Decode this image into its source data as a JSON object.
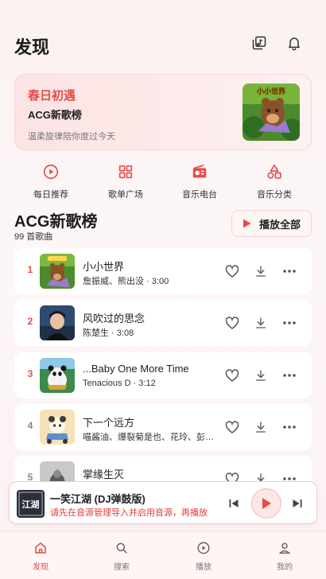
{
  "header": {
    "title": "发现",
    "icons": [
      "music-library-icon",
      "bell-icon"
    ]
  },
  "banner": {
    "title": "春日初遇",
    "subtitle": "ACG新歌榜",
    "description": "温柔旋律陪你度过今天",
    "art_text": "小小世界"
  },
  "quick_links": [
    {
      "label": "每日推荐",
      "icon": "play-circle-icon"
    },
    {
      "label": "歌单广场",
      "icon": "grid-icon"
    },
    {
      "label": "音乐电台",
      "icon": "radio-icon"
    },
    {
      "label": "音乐分类",
      "icon": "category-shapes-icon"
    }
  ],
  "section": {
    "title": "ACG新歌榜",
    "count": "99 首歌曲",
    "play_all_label": "播放全部"
  },
  "songs": [
    {
      "index": "1",
      "title": "小小世界",
      "meta": "詹振威、熊出没 · 3:00"
    },
    {
      "index": "2",
      "title": "风吹过的思念",
      "meta": "陈楚生 · 3:08"
    },
    {
      "index": "3",
      "title": "...Baby One More Time",
      "meta": "Tenacious D · 3:12"
    },
    {
      "index": "4",
      "title": "下一个远方",
      "meta": "喵酱油、爆裂菊是也、花玲、彭…"
    },
    {
      "index": "5",
      "title": "掌缘生灭",
      "meta": ""
    }
  ],
  "player": {
    "title": "一笑江湖 (DJ弹鼓版)",
    "status": "请先在音源管理导入并启用音源，再播放",
    "cover_text": "江湖"
  },
  "tabs": [
    {
      "label": "发现",
      "icon": "home-icon",
      "active": true
    },
    {
      "label": "搜索",
      "icon": "search-icon",
      "active": false
    },
    {
      "label": "播放",
      "icon": "play-circle-icon",
      "active": false
    },
    {
      "label": "我的",
      "icon": "user-icon",
      "active": false
    }
  ],
  "colors": {
    "accent": "#e64b4b",
    "rank_top": "#e64b4b",
    "rank_other": "#888888",
    "background": "#fbf1f1"
  }
}
